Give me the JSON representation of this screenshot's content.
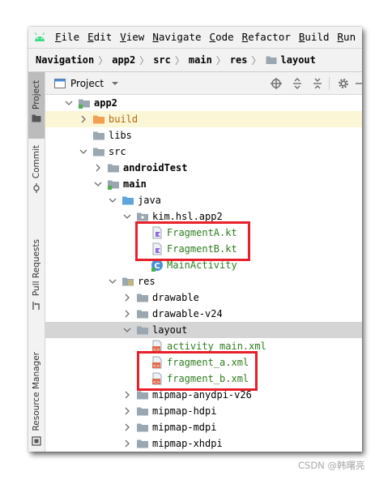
{
  "menu": {
    "items": [
      {
        "mnemonic": "F",
        "rest": "ile"
      },
      {
        "mnemonic": "E",
        "rest": "dit"
      },
      {
        "mnemonic": "V",
        "rest": "iew"
      },
      {
        "mnemonic": "N",
        "rest": "avigate"
      },
      {
        "mnemonic": "C",
        "rest": "ode"
      },
      {
        "mnemonic": "R",
        "rest": "efactor"
      },
      {
        "mnemonic": "B",
        "rest": "uild"
      },
      {
        "mnemonic": "R",
        "rest": "un"
      }
    ]
  },
  "breadcrumb": [
    "Navigation",
    "app2",
    "src",
    "main",
    "res",
    "layout"
  ],
  "left_tabs": {
    "project": "Project",
    "commit": "Commit",
    "pull_requests": "Pull Requests",
    "resource_manager": "Resource Manager"
  },
  "project_panel": {
    "title": "Project"
  },
  "tree": [
    {
      "label": "app2"
    },
    {
      "label": "build"
    },
    {
      "label": "libs"
    },
    {
      "label": "src"
    },
    {
      "label": "androidTest"
    },
    {
      "label": "main"
    },
    {
      "label": "java"
    },
    {
      "label": "kim.hsl.app2"
    },
    {
      "label": "FragmentA.kt"
    },
    {
      "label": "FragmentB.kt"
    },
    {
      "label": "MainActivity"
    },
    {
      "label": "res"
    },
    {
      "label": "drawable"
    },
    {
      "label": "drawable-v24"
    },
    {
      "label": "layout"
    },
    {
      "label": "activity_main.xml"
    },
    {
      "label": "fragment_a.xml"
    },
    {
      "label": "fragment_b.xml"
    },
    {
      "label": "mipmap-anydpi-v26"
    },
    {
      "label": "mipmap-hdpi"
    },
    {
      "label": "mipmap-mdpi"
    },
    {
      "label": "mipmap-xhdpi"
    }
  ],
  "icons": {
    "android": "android-logo-icon",
    "folder": "folder-icon",
    "kotlin": "kotlin-file-icon",
    "xml": "xml-layout-icon",
    "class": "class-icon"
  },
  "colors": {
    "highlight_box": "#e8202a",
    "version_control_new": "#2f7d1f",
    "selected_row": "#d5d5d5",
    "excluded_row": "#fbf6d6"
  },
  "watermark": "CSDN @韩曙亮"
}
